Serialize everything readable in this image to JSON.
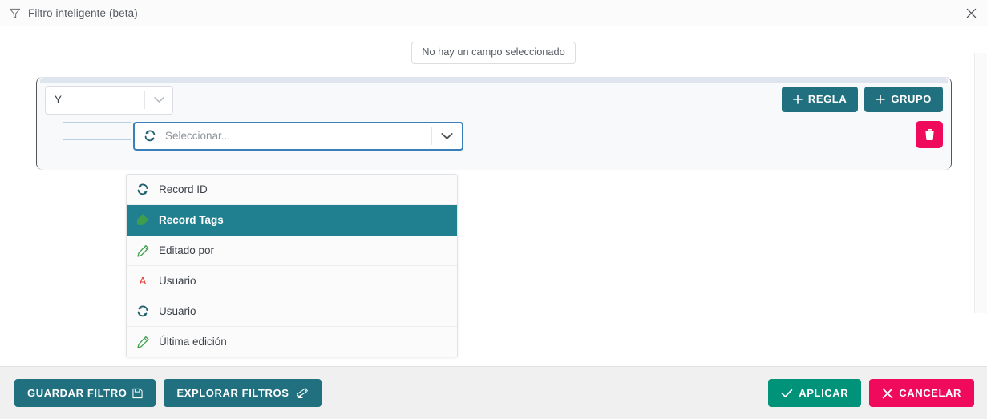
{
  "window": {
    "title": "Filtro inteligente (beta)",
    "title_icon": "filter-funnel-icon",
    "close_icon": "close-icon"
  },
  "field_chip": {
    "label": "No hay un campo seleccionado"
  },
  "group": {
    "operator_select": {
      "value": "Y",
      "chevron_icon": "chevron-down-icon"
    },
    "add_rule_button": {
      "label": "REGLA",
      "icon": "plus-icon"
    },
    "add_group_button": {
      "label": "GRUPO",
      "icon": "plus-icon"
    },
    "rule": {
      "field_select": {
        "placeholder": "Seleccionar...",
        "value": "",
        "leading_icon": "sync-arrows-icon",
        "chevron_icon": "chevron-down-icon"
      },
      "delete_button": {
        "icon": "trash-icon",
        "label": ""
      }
    }
  },
  "dropdown": {
    "items": [
      {
        "label": "Record ID",
        "icon": "sync-arrows-icon",
        "selected": false
      },
      {
        "label": "Record Tags",
        "icon": "tag-icon",
        "selected": true
      },
      {
        "label": "Editado por",
        "icon": "pencil-icon",
        "selected": false
      },
      {
        "label": "Usuario",
        "icon": "letter-a-icon",
        "selected": false
      },
      {
        "label": "Usuario",
        "icon": "sync-arrows-icon",
        "selected": false
      },
      {
        "label": "Última edición",
        "icon": "pencil-icon",
        "selected": false
      }
    ]
  },
  "footer": {
    "save_filter_button": {
      "label": "GUARDAR FILTRO",
      "icon": "save-icon"
    },
    "explore_filters_button": {
      "label": "EXPLORAR FILTROS",
      "icon": "telescope-icon"
    },
    "apply_button": {
      "label": "APLICAR",
      "icon": "check-icon"
    },
    "cancel_button": {
      "label": "CANCELAR",
      "icon": "close-x-icon"
    }
  },
  "colors": {
    "teal": "#21707f",
    "teal_selected": "#21808f",
    "green": "#00937a",
    "pink": "#ef0a5c",
    "focus_blue": "#3a7fba",
    "icon_green": "#3f9e4d",
    "icon_red": "#e23a30",
    "icon_dark_teal": "#1f5f6e"
  }
}
